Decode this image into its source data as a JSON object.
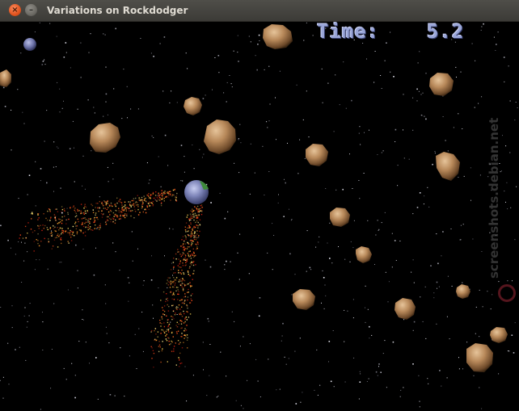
{
  "window": {
    "title": "Variations on Rockdodger",
    "close_icon": "close-icon",
    "minimize_icon": "minimize-icon"
  },
  "hud": {
    "time_label": "Time:",
    "time_value": "5.2"
  },
  "watermark": {
    "text": "screenshots.debian.net"
  },
  "colors": {
    "background": "#000000",
    "hud_text": "#9aa6d8",
    "rock": "#b8895a",
    "ship": "#7d84b8",
    "titlebar": "#3c3b37"
  }
}
